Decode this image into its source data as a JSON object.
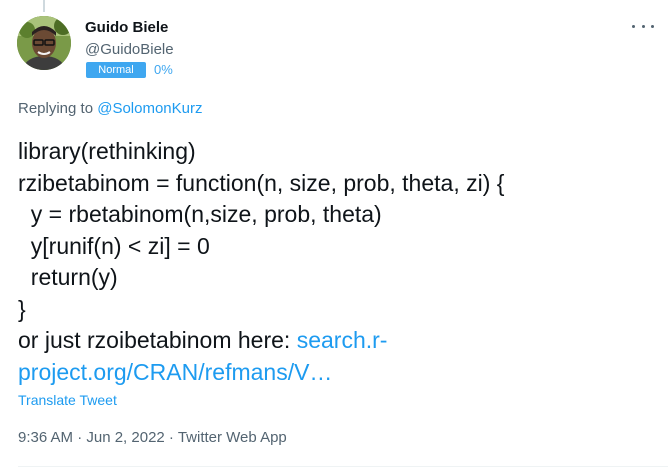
{
  "author": {
    "name": "Guido Biele",
    "handle": "@GuidoBiele",
    "badge": "Normal",
    "badge_percent": "0%"
  },
  "reply": {
    "prefix": "Replying to ",
    "to": "@SolomonKurz"
  },
  "tweet": {
    "lines": [
      "library(rethinking)",
      "rzibetabinom = function(n, size, prob, theta, zi) {",
      "  y = rbetabinom(n,size, prob, theta)",
      "  y[runif(n) < zi] = 0",
      "  return(y)",
      "}"
    ],
    "link_intro": "or just rzoibetabinom here: ",
    "link_part1": "search.r-",
    "link_part2": "project.org/CRAN/refmans/V…"
  },
  "translate_label": "Translate Tweet",
  "meta": "9:36 AM · Jun 2, 2022 · Twitter Web App",
  "colors": {
    "accent": "#1d9bf0",
    "badge": "#3fa7f0",
    "muted": "#536471"
  },
  "icons": {
    "more": "more-horizontal-icon",
    "avatar": "avatar"
  }
}
